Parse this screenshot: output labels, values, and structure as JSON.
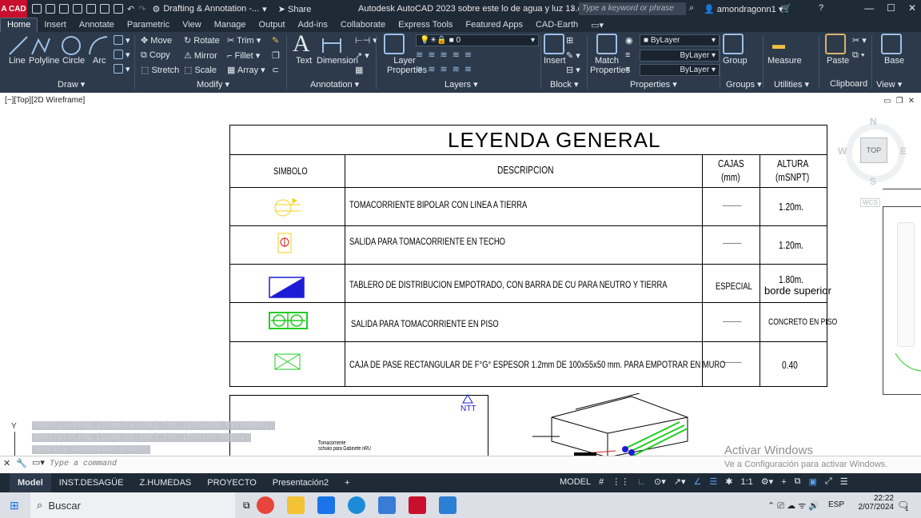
{
  "titlebar": {
    "logo": "A CAD",
    "workspace": "Drafting & Annotation -...",
    "share": "Share",
    "title": "Autodesk AutoCAD 2023    sobre este lo de agua y luz 13.dwg",
    "search_placeholder": "Type a keyword or phrase",
    "user": "amondragonn1"
  },
  "tabs": [
    "Home",
    "Insert",
    "Annotate",
    "Parametric",
    "View",
    "Manage",
    "Output",
    "Add-ins",
    "Collaborate",
    "Express Tools",
    "Featured Apps",
    "CAD-Earth"
  ],
  "ribbon": {
    "draw": {
      "line": "Line",
      "polyline": "Polyline",
      "circle": "Circle",
      "arc": "Arc",
      "label": "Draw"
    },
    "modify": {
      "move": "Move",
      "rotate": "Rotate",
      "trim": "Trim",
      "copy": "Copy",
      "mirror": "Mirror",
      "fillet": "Fillet",
      "stretch": "Stretch",
      "scale": "Scale",
      "array": "Array",
      "label": "Modify"
    },
    "annotation": {
      "text": "Text",
      "dimension": "Dimension",
      "label": "Annotation"
    },
    "layers": {
      "layer_props": "Layer Properties",
      "current": "0",
      "label": "Layers"
    },
    "block": {
      "insert": "Insert",
      "label": "Block"
    },
    "properties": {
      "match": "Match Properties",
      "bylayer1": "ByLayer",
      "bylayer2": "ByLayer",
      "bylayer3": "ByLayer",
      "label": "Properties"
    },
    "groups": {
      "group": "Group",
      "label": "Groups"
    },
    "utilities": {
      "measure": "Measure",
      "label": "Utilities"
    },
    "clipboard": {
      "paste": "Paste",
      "label": "Clipboard"
    },
    "view": {
      "base": "Base",
      "label": "View"
    }
  },
  "viewport": {
    "label": "[−][Top][2D Wireframe]"
  },
  "viewcube": {
    "n": "N",
    "s": "S",
    "e": "E",
    "w": "W",
    "top": "TOP",
    "wcs": "WCS"
  },
  "legend": {
    "title": "LEYENDA GENERAL",
    "headers": {
      "simbolo": "SIMBOLO",
      "descripcion": "DESCRIPCION",
      "cajas": "CAJAS",
      "cajas_unit": "(mm)",
      "altura": "ALTURA",
      "altura_unit": "(mSNPT)"
    },
    "rows": [
      {
        "desc": "TOMACORRIENTE BIPOLAR CON LINEA A TIERRA",
        "cajas": "———",
        "altura": "1.20m."
      },
      {
        "desc": "SALIDA PARA TOMACORRIENTE EN TECHO",
        "cajas": "———",
        "altura": "1.20m."
      },
      {
        "desc": "TABLERO DE DISTRIBUCION EMPOTRADO, CON BARRA DE CU PARA NEUTRO Y TIERRA",
        "cajas": "ESPECIAL",
        "altura": "1.80m.",
        "altura2": "borde superior"
      },
      {
        "desc": "SALIDA PARA TOMACORRIENTE EN PISO",
        "cajas": "———",
        "altura": "CONCRETO EN PISO"
      },
      {
        "desc": "CAJA DE PASE RECTANGULAR  DE F°G°  ESPESOR 1.2mm DE 100x55x50 mm. PARA EMPOTRAR EN MURO",
        "cajas": "———",
        "altura": "0.40"
      }
    ]
  },
  "drawing": {
    "ntt": "NTT",
    "note1": "Tomacorriente",
    "note2": "schuko para Gabinete nRU"
  },
  "console": [
    "Substituting [simplex.shx] for [Univers Extended].",
    "Substituting [simplex.shx] for [Encino Caps].",
    "Specify insertion point:"
  ],
  "command": {
    "placeholder": "Type a command"
  },
  "watermark": {
    "line1": "Activar Windows",
    "line2": "Ve a Configuración para activar Windows."
  },
  "layouts": [
    "Model",
    "INST.DESAGÜE",
    "Z.HUMEDAS",
    "PROYECTO",
    "Presentación2"
  ],
  "status": {
    "model": "MODEL",
    "scale": "1:1"
  },
  "taskbar": {
    "search": "Buscar",
    "lang": "ESP",
    "time": "22:22",
    "date": "2/07/2024",
    "notif": "1"
  }
}
